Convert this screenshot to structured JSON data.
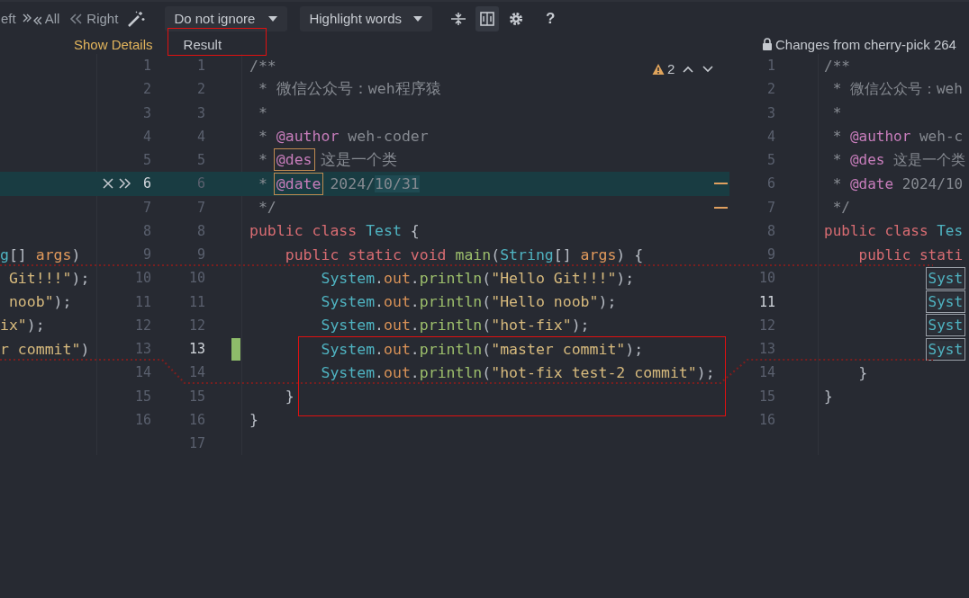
{
  "toolbar": {
    "actions": [
      {
        "kind": "left",
        "label": "eft"
      },
      {
        "kind": "all",
        "label": "All"
      },
      {
        "kind": "right",
        "label": "Right"
      }
    ],
    "dropdowns": [
      {
        "value": "Do not ignore"
      },
      {
        "value": "Highlight words"
      }
    ],
    "tools": [
      {
        "kind": "collapse",
        "selected": false
      },
      {
        "kind": "columns",
        "selected": true
      },
      {
        "kind": "settings",
        "selected": false
      }
    ],
    "help": "?"
  },
  "header": {
    "show_details": "Show Details",
    "result_title": "Result",
    "result_title_boxed": true,
    "right_title": "Changes from cherry-pick 264",
    "right_locked": true
  },
  "inspection": {
    "count": "2"
  },
  "left_pane": {
    "lines": [
      {
        "number": "1",
        "current": false,
        "changed": false,
        "actions": false
      },
      {
        "number": "2",
        "current": false,
        "changed": false,
        "actions": false
      },
      {
        "number": "3",
        "current": false,
        "changed": false,
        "actions": false
      },
      {
        "number": "4",
        "current": false,
        "changed": false,
        "actions": false
      },
      {
        "number": "5",
        "current": false,
        "changed": false,
        "actions": false
      },
      {
        "number": "6",
        "current": true,
        "changed": true,
        "actions": true
      },
      {
        "number": "7",
        "current": false,
        "changed": false,
        "actions": false
      },
      {
        "number": "8",
        "current": false,
        "changed": false,
        "actions": false
      },
      {
        "number": "9",
        "current": false,
        "changed": false,
        "actions": false,
        "tokens": [
          {
            "text": "g",
            "kind": "type"
          },
          {
            "text": "[] ",
            "kind": "punct"
          },
          {
            "text": "args",
            "kind": "param"
          },
          {
            "text": ")",
            "kind": "punct"
          }
        ]
      },
      {
        "number": "10",
        "current": false,
        "changed": false,
        "actions": false,
        "tokens": [
          {
            "text": " Git!!!\"",
            "kind": "string"
          },
          {
            "text": ");",
            "kind": "punct"
          }
        ]
      },
      {
        "number": "11",
        "current": false,
        "changed": false,
        "actions": false,
        "tokens": [
          {
            "text": " noob\"",
            "kind": "string"
          },
          {
            "text": ");",
            "kind": "punct"
          }
        ]
      },
      {
        "number": "12",
        "current": false,
        "changed": false,
        "actions": false,
        "tokens": [
          {
            "text": "ix\"",
            "kind": "string"
          },
          {
            "text": ");",
            "kind": "punct"
          }
        ]
      },
      {
        "number": "13",
        "current": false,
        "changed": false,
        "actions": false,
        "tokens": [
          {
            "text": "r commit\"",
            "kind": "string"
          },
          {
            "text": ")",
            "kind": "punct"
          }
        ]
      },
      {
        "number": "14",
        "current": false,
        "changed": false,
        "actions": false
      },
      {
        "number": "15",
        "current": false,
        "changed": false,
        "actions": false
      },
      {
        "number": "16",
        "current": false,
        "changed": false,
        "actions": false
      }
    ]
  },
  "result_pane": {
    "conflict_boxed": true,
    "lines": [
      {
        "number": "1",
        "current": false,
        "changed": false,
        "change_marker": false,
        "conflict_mark": false,
        "tokens": [
          {
            "text": "/**",
            "kind": "comment"
          }
        ]
      },
      {
        "number": "2",
        "current": false,
        "changed": false,
        "change_marker": false,
        "conflict_mark": false,
        "tokens": [
          {
            "text": " * 微信公众号：weh程序猿",
            "kind": "comment"
          }
        ]
      },
      {
        "number": "3",
        "current": false,
        "changed": false,
        "change_marker": false,
        "conflict_mark": false,
        "tokens": [
          {
            "text": " *",
            "kind": "comment"
          }
        ]
      },
      {
        "number": "4",
        "current": false,
        "changed": false,
        "change_marker": false,
        "conflict_mark": false,
        "tokens": [
          {
            "text": " * ",
            "kind": "comment"
          },
          {
            "text": "@author",
            "kind": "doctag"
          },
          {
            "text": " weh-coder",
            "kind": "comment"
          }
        ]
      },
      {
        "number": "5",
        "current": false,
        "changed": false,
        "change_marker": false,
        "conflict_mark": false,
        "tokens": [
          {
            "text": " * ",
            "kind": "comment"
          },
          {
            "text": "@des",
            "kind": "doctag",
            "boxed": true
          },
          {
            "text": " 这是一个类",
            "kind": "comment"
          }
        ]
      },
      {
        "number": "6",
        "current": false,
        "changed": true,
        "change_marker": false,
        "conflict_mark": true,
        "tokens": [
          {
            "text": " * ",
            "kind": "comment"
          },
          {
            "text": "@date",
            "kind": "doctag",
            "boxed": true
          },
          {
            "text": " 2024/",
            "kind": "comment"
          },
          {
            "text": "10/31",
            "kind": "comment",
            "inline_change": true
          }
        ]
      },
      {
        "number": "7",
        "current": false,
        "changed": false,
        "change_marker": false,
        "conflict_mark": true,
        "tokens": [
          {
            "text": " */",
            "kind": "comment"
          }
        ]
      },
      {
        "number": "8",
        "current": false,
        "changed": false,
        "change_marker": false,
        "conflict_mark": false,
        "tokens": [
          {
            "text": "public class ",
            "kind": "keyword"
          },
          {
            "text": "Test",
            "kind": "type"
          },
          {
            "text": " {",
            "kind": "punct"
          }
        ]
      },
      {
        "number": "9",
        "current": false,
        "changed": false,
        "change_marker": false,
        "conflict_mark": false,
        "tokens": [
          {
            "text": "    public static void ",
            "kind": "keyword"
          },
          {
            "text": "main",
            "kind": "method"
          },
          {
            "text": "(",
            "kind": "punct"
          },
          {
            "text": "String",
            "kind": "type"
          },
          {
            "text": "[] ",
            "kind": "punct"
          },
          {
            "text": "args",
            "kind": "param"
          },
          {
            "text": ") {",
            "kind": "punct"
          }
        ]
      },
      {
        "number": "10",
        "current": false,
        "changed": false,
        "change_marker": false,
        "conflict_mark": false,
        "tokens": [
          {
            "text": "        System",
            "kind": "type"
          },
          {
            "text": ".",
            "kind": "punct"
          },
          {
            "text": "out",
            "kind": "field"
          },
          {
            "text": ".",
            "kind": "punct"
          },
          {
            "text": "println",
            "kind": "method"
          },
          {
            "text": "(",
            "kind": "punct"
          },
          {
            "text": "\"Hello Git!!!\"",
            "kind": "string"
          },
          {
            "text": ");",
            "kind": "punct"
          }
        ]
      },
      {
        "number": "11",
        "current": false,
        "changed": false,
        "change_marker": false,
        "conflict_mark": false,
        "tokens": [
          {
            "text": "        System",
            "kind": "type"
          },
          {
            "text": ".",
            "kind": "punct"
          },
          {
            "text": "out",
            "kind": "field"
          },
          {
            "text": ".",
            "kind": "punct"
          },
          {
            "text": "println",
            "kind": "method"
          },
          {
            "text": "(",
            "kind": "punct"
          },
          {
            "text": "\"Hello noob\"",
            "kind": "string"
          },
          {
            "text": ");",
            "kind": "punct"
          }
        ]
      },
      {
        "number": "12",
        "current": false,
        "changed": false,
        "change_marker": false,
        "conflict_mark": false,
        "tokens": [
          {
            "text": "        System",
            "kind": "type"
          },
          {
            "text": ".",
            "kind": "punct"
          },
          {
            "text": "out",
            "kind": "field"
          },
          {
            "text": ".",
            "kind": "punct"
          },
          {
            "text": "println",
            "kind": "method"
          },
          {
            "text": "(",
            "kind": "punct"
          },
          {
            "text": "\"hot-fix\"",
            "kind": "string"
          },
          {
            "text": ");",
            "kind": "punct"
          }
        ]
      },
      {
        "number": "13",
        "current": true,
        "changed": false,
        "change_marker": true,
        "conflict_mark": false,
        "tokens": [
          {
            "text": "        System",
            "kind": "type"
          },
          {
            "text": ".",
            "kind": "punct"
          },
          {
            "text": "out",
            "kind": "field"
          },
          {
            "text": ".",
            "kind": "punct"
          },
          {
            "text": "println",
            "kind": "method"
          },
          {
            "text": "(",
            "kind": "punct"
          },
          {
            "text": "\"master commit\"",
            "kind": "string"
          },
          {
            "text": ");",
            "kind": "punct"
          }
        ]
      },
      {
        "number": "14",
        "current": false,
        "changed": false,
        "change_marker": false,
        "conflict_mark": false,
        "tokens": [
          {
            "text": "        System",
            "kind": "type"
          },
          {
            "text": ".",
            "kind": "punct"
          },
          {
            "text": "out",
            "kind": "field"
          },
          {
            "text": ".",
            "kind": "punct"
          },
          {
            "text": "println",
            "kind": "method"
          },
          {
            "text": "(",
            "kind": "punct"
          },
          {
            "text": "\"hot-fix test-2 commit\"",
            "kind": "string"
          },
          {
            "text": ");",
            "kind": "punct"
          }
        ]
      },
      {
        "number": "15",
        "current": false,
        "changed": false,
        "change_marker": false,
        "conflict_mark": false,
        "tokens": [
          {
            "text": "    }",
            "kind": "punct"
          }
        ]
      },
      {
        "number": "16",
        "current": false,
        "changed": false,
        "change_marker": false,
        "conflict_mark": false,
        "tokens": [
          {
            "text": "}",
            "kind": "punct"
          }
        ]
      },
      {
        "number": "17",
        "current": false,
        "changed": false,
        "change_marker": false,
        "conflict_mark": false
      }
    ]
  },
  "right_pane": {
    "lines": [
      {
        "number": "1",
        "current": false,
        "tokens": [
          {
            "text": "/**",
            "kind": "comment"
          }
        ]
      },
      {
        "number": "2",
        "current": false,
        "tokens": [
          {
            "text": " * 微信公众号：weh",
            "kind": "comment"
          }
        ]
      },
      {
        "number": "3",
        "current": false,
        "tokens": [
          {
            "text": " *",
            "kind": "comment"
          }
        ]
      },
      {
        "number": "4",
        "current": false,
        "tokens": [
          {
            "text": " * ",
            "kind": "comment"
          },
          {
            "text": "@author",
            "kind": "doctag"
          },
          {
            "text": " weh-c",
            "kind": "comment"
          }
        ]
      },
      {
        "number": "5",
        "current": false,
        "tokens": [
          {
            "text": " * ",
            "kind": "comment"
          },
          {
            "text": "@des",
            "kind": "doctag"
          },
          {
            "text": " 这是一个类",
            "kind": "comment"
          }
        ]
      },
      {
        "number": "6",
        "current": false,
        "tokens": [
          {
            "text": " * ",
            "kind": "comment"
          },
          {
            "text": "@date",
            "kind": "doctag"
          },
          {
            "text": " 2024/10",
            "kind": "comment"
          }
        ]
      },
      {
        "number": "7",
        "current": false,
        "tokens": [
          {
            "text": " */",
            "kind": "comment"
          }
        ]
      },
      {
        "number": "8",
        "current": false,
        "tokens": [
          {
            "text": "public class ",
            "kind": "keyword"
          },
          {
            "text": "Tes",
            "kind": "type"
          }
        ]
      },
      {
        "number": "9",
        "current": false,
        "tokens": [
          {
            "text": "    public stati",
            "kind": "keyword"
          }
        ]
      },
      {
        "number": "10",
        "current": false,
        "tokens": [
          {
            "text": "            Syst",
            "kind": "type",
            "boxed": true
          }
        ]
      },
      {
        "number": "11",
        "current": true,
        "tokens": [
          {
            "text": "            Syst",
            "kind": "type",
            "boxed": true
          }
        ]
      },
      {
        "number": "12",
        "current": false,
        "tokens": [
          {
            "text": "            Syst",
            "kind": "type",
            "boxed": true
          }
        ]
      },
      {
        "number": "13",
        "current": false,
        "tokens": [
          {
            "text": "            Syst",
            "kind": "type",
            "boxed": true
          }
        ]
      },
      {
        "number": "14",
        "current": false,
        "tokens": [
          {
            "text": "    }",
            "kind": "punct"
          }
        ]
      },
      {
        "number": "15",
        "current": false,
        "tokens": [
          {
            "text": "}",
            "kind": "punct"
          }
        ]
      },
      {
        "number": "16",
        "current": false
      }
    ]
  }
}
